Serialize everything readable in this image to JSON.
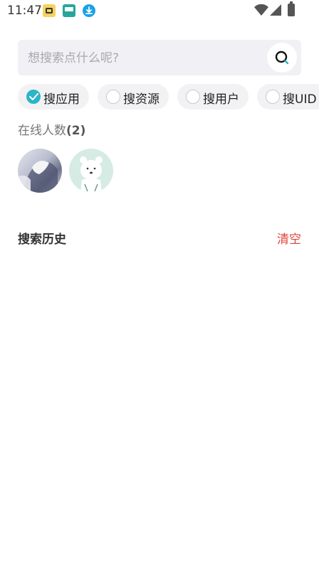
{
  "status_bar": {
    "time": "11:47",
    "icons": [
      "app-notification-icon",
      "app-notification-icon",
      "download-icon",
      "wifi-icon",
      "signal-icon",
      "battery-charging-icon"
    ]
  },
  "search": {
    "placeholder": "想搜索点什么呢?",
    "value": ""
  },
  "filters": [
    {
      "label": "搜应用",
      "selected": true
    },
    {
      "label": "搜资源",
      "selected": false
    },
    {
      "label": "搜用户",
      "selected": false
    },
    {
      "label": "搜UID",
      "selected": false
    }
  ],
  "online": {
    "title": "在线人数",
    "count": "(2)"
  },
  "history": {
    "title": "搜索历史",
    "clear_label": "清空"
  },
  "colors": {
    "accent": "#2bb5c7",
    "clear": "#e0433a",
    "search_bg": "#f0f0f5"
  }
}
